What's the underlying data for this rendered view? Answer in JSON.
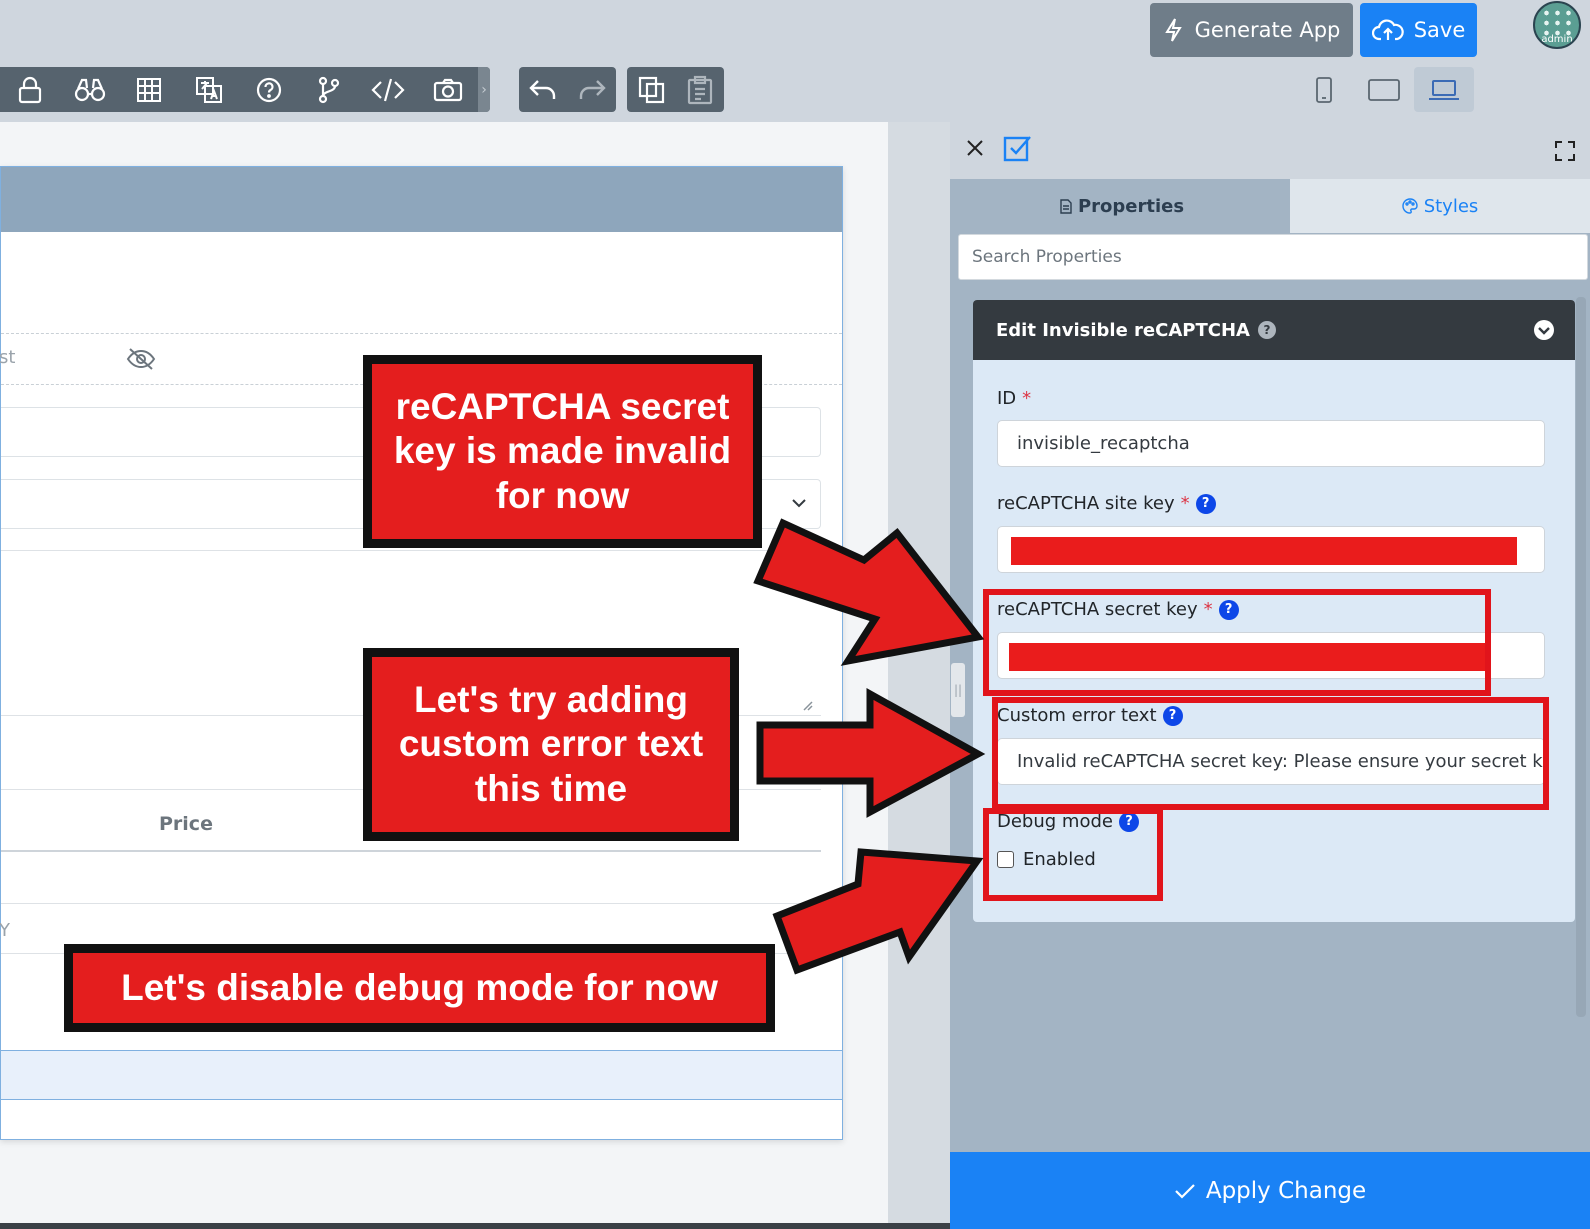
{
  "topbar": {
    "generate_label": "Generate App",
    "save_label": "Save",
    "avatar_label": "admin",
    "tools": [
      "lock-icon",
      "binoculars-icon",
      "table-icon",
      "translate-icon",
      "help-icon",
      "branch-icon",
      "code-icon",
      "camera-icon"
    ],
    "history": [
      "undo-icon",
      "redo-icon"
    ],
    "clipboard": [
      "copy-icon",
      "paste-icon"
    ],
    "devices": [
      "phone-icon",
      "tablet-icon",
      "laptop-icon"
    ]
  },
  "canvas": {
    "fragment_left_1": "st",
    "fragment_left_2": "Y",
    "column_price": "Price"
  },
  "panel": {
    "tab_properties": "Properties",
    "tab_styles": "Styles",
    "search_placeholder": "Search Properties",
    "section_title": "Edit Invisible reCAPTCHA",
    "fields": {
      "id_label": "ID",
      "id_value": "invisible_recaptcha",
      "site_key_label": "reCAPTCHA site key",
      "secret_key_label": "reCAPTCHA secret key",
      "error_text_label": "Custom error text",
      "error_text_value": "Invalid reCAPTCHA secret key: Please ensure your secret key is correct",
      "debug_label": "Debug mode",
      "debug_option": "Enabled",
      "required_mark": "*"
    },
    "apply_label": "Apply Change"
  },
  "annotations": {
    "secret_key_note": "reCAPTCHA secret key is made invalid for now",
    "error_text_note": "Let's try adding custom error text this time",
    "debug_note": "Let's disable debug mode for now"
  },
  "colors": {
    "accent": "#1a82f5",
    "annotation_red": "#e41e1e",
    "panel_bg": "#a3b4c4",
    "header_dark": "#343a40"
  }
}
